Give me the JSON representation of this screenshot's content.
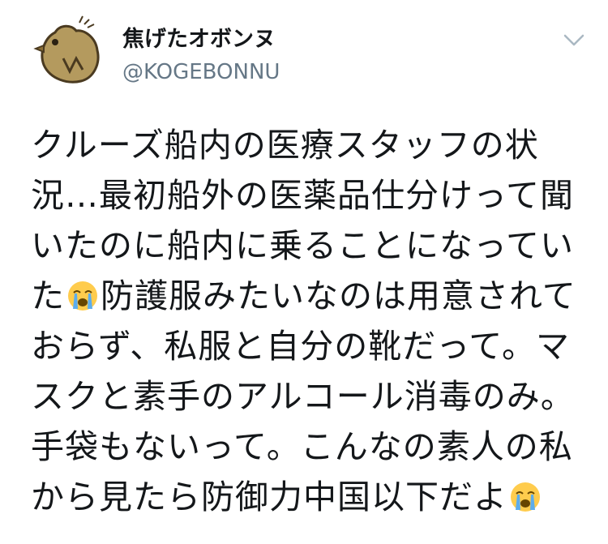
{
  "tweet": {
    "author": {
      "display_name": "焦げたオボンヌ",
      "handle": "@KOGEBONNU",
      "avatar_icon": "burnt-bird-avatar-icon"
    },
    "menu_icon": "chevron-down-icon",
    "text_lines": [
      {
        "before": "クルーズ船内の医療スタッフの状",
        "emoji": null,
        "after": ""
      },
      {
        "before": "況…最初船外の医薬品仕分けって聞",
        "emoji": null,
        "after": ""
      },
      {
        "before": "いたのに船内に乗ることになってい",
        "emoji": null,
        "after": ""
      },
      {
        "before": "た",
        "emoji": "loudly-crying-face-icon",
        "after": "防護服みたいなのは用意されて"
      },
      {
        "before": "おらず、私服と自分の靴だって。マ",
        "emoji": null,
        "after": ""
      },
      {
        "before": "スクと素手のアルコール消毒のみ。",
        "emoji": null,
        "after": ""
      },
      {
        "before": "手袋もないって。こんなの素人の私",
        "emoji": null,
        "after": ""
      },
      {
        "before": "から見たら防御力中国以下だよ",
        "emoji": "loudly-crying-face-icon",
        "after": ""
      }
    ],
    "colors": {
      "name": "#14171a",
      "handle": "#657786",
      "caret": "#aab8c2",
      "avatar_fill": "#b49a5e"
    }
  }
}
